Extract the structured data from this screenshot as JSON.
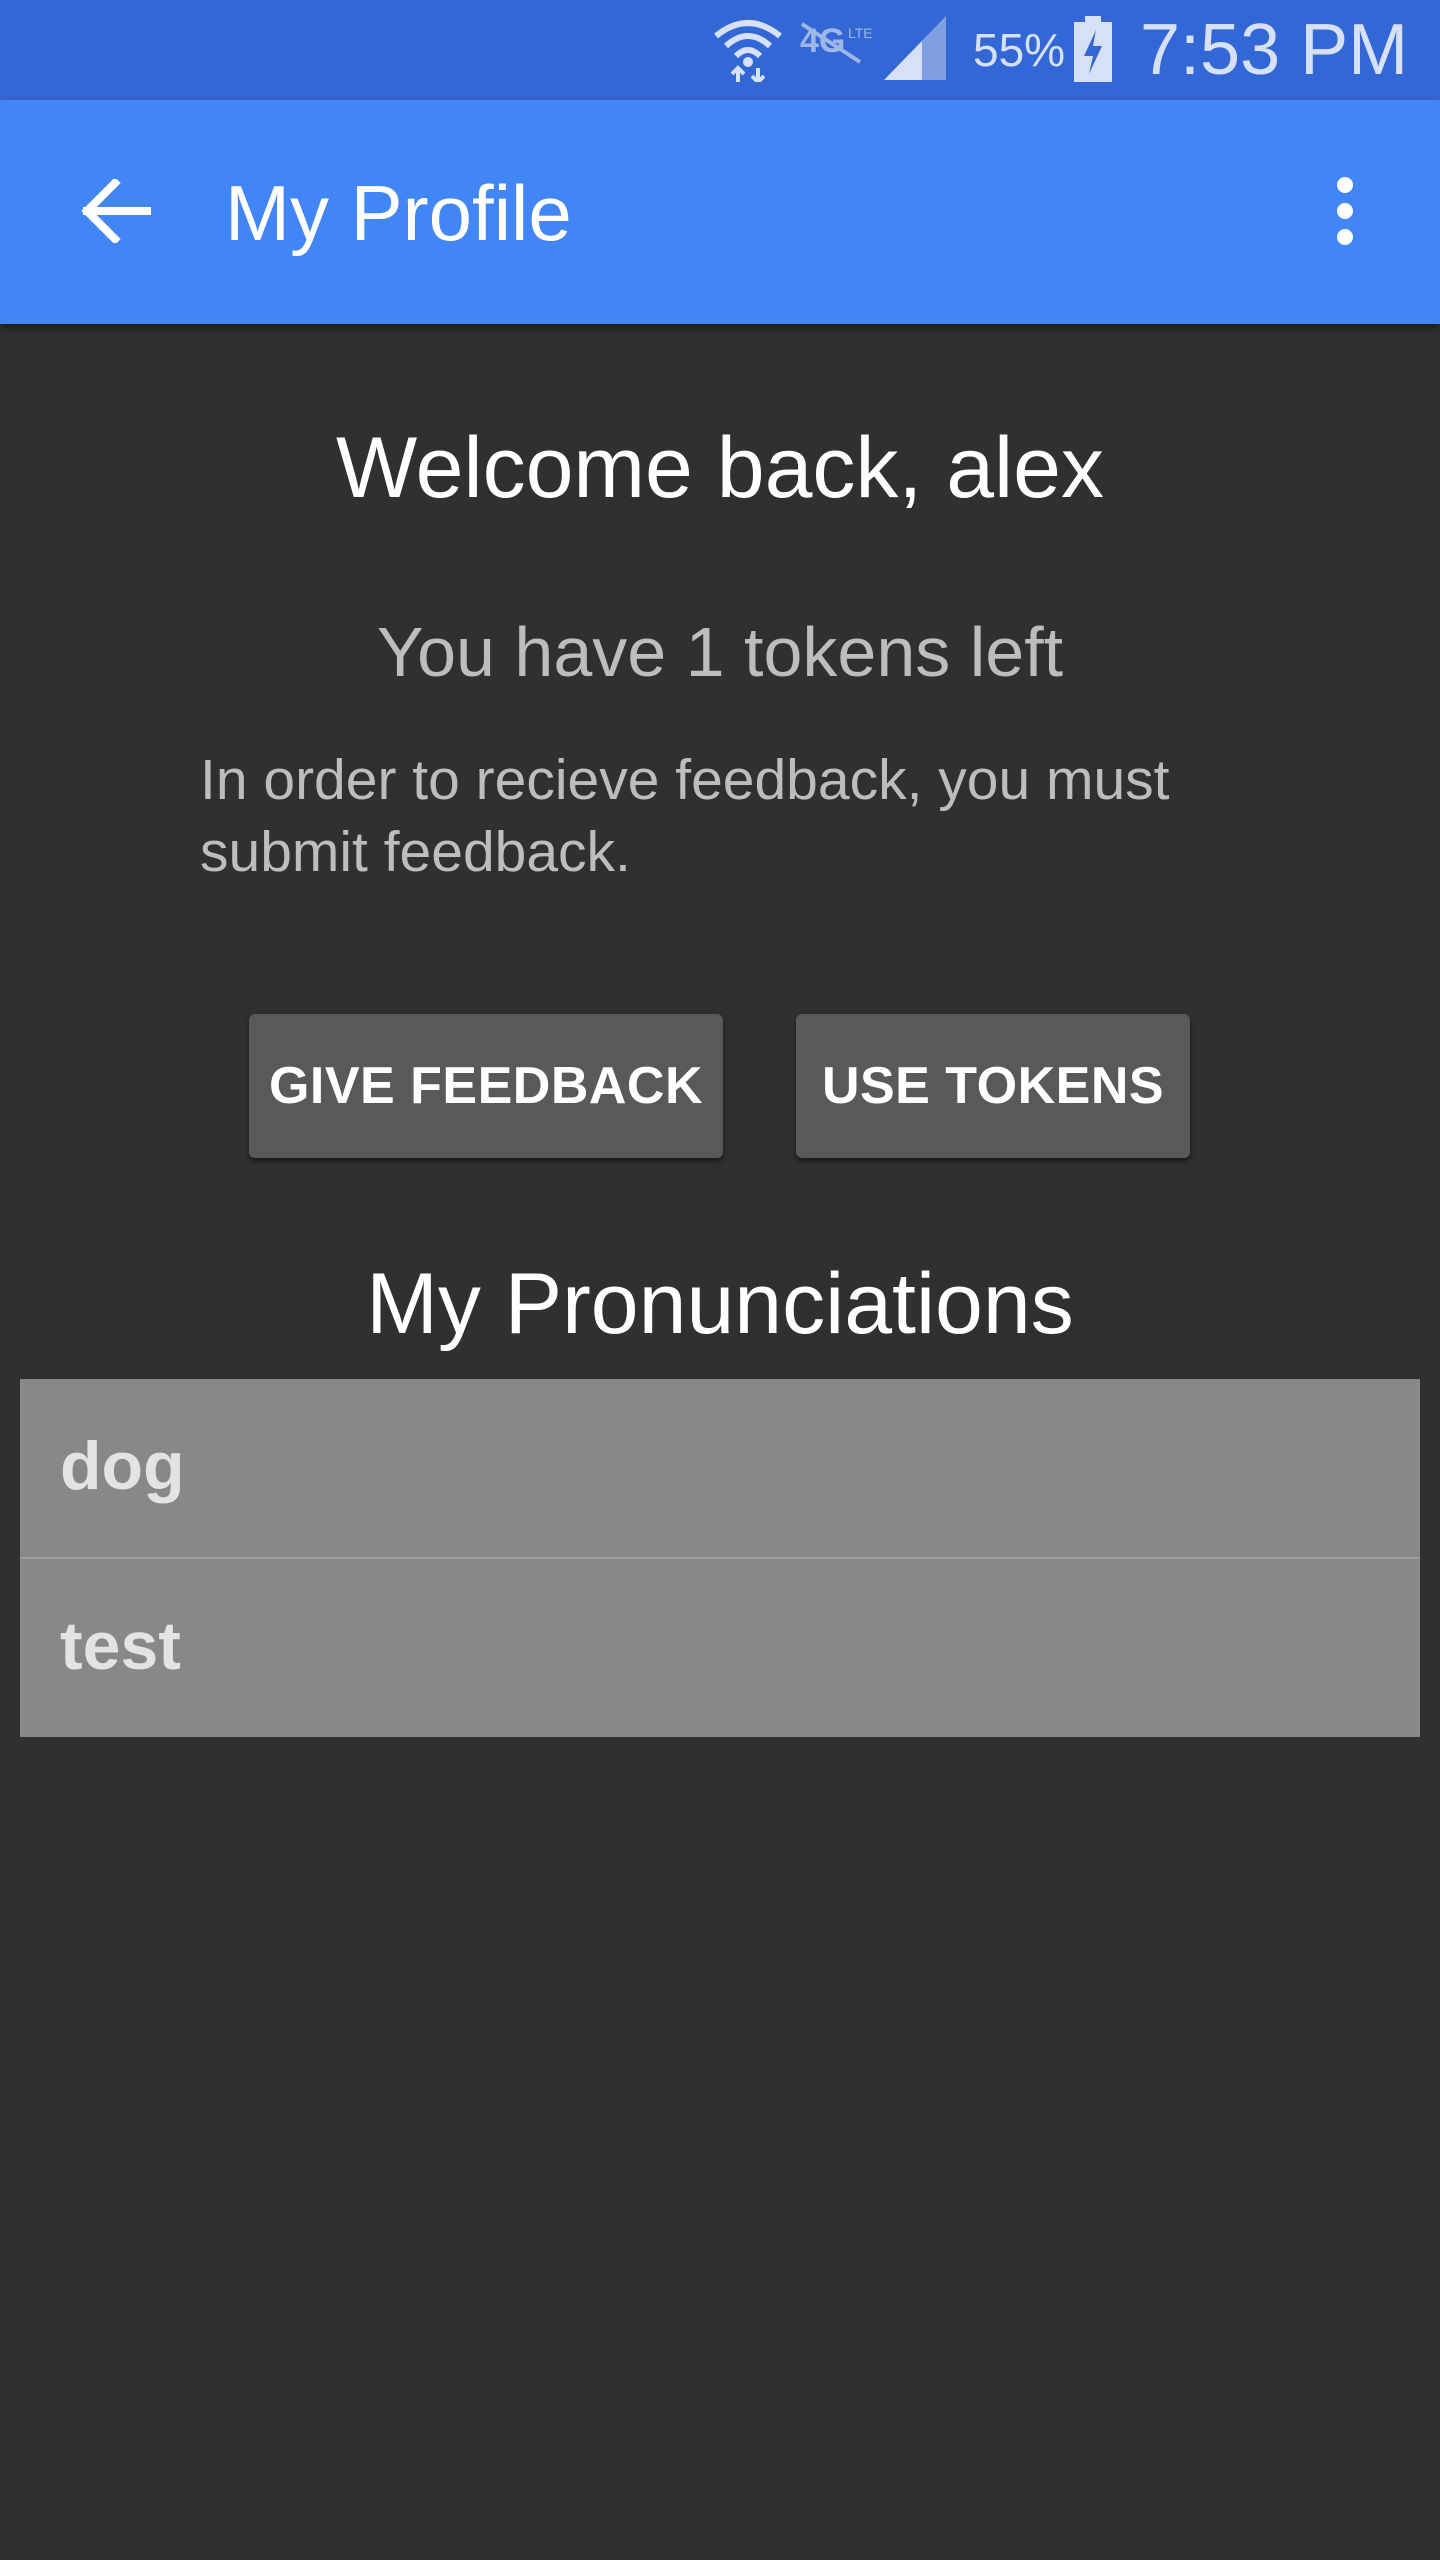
{
  "status_bar": {
    "battery_percent": "55%",
    "time": "7:53 PM",
    "icons": [
      "wifi-icon",
      "lte-icon",
      "signal-icon",
      "battery-charging-icon"
    ]
  },
  "app_bar": {
    "title": "My Profile",
    "back_icon": "arrow-back-icon",
    "menu_icon": "more-vert-icon"
  },
  "profile": {
    "welcome": "Welcome back, alex",
    "tokens_text": "You have 1 tokens left",
    "info_text": "In order to recieve feedback, you must submit feedback."
  },
  "actions": {
    "give_feedback_label": "GIVE FEEDBACK",
    "use_tokens_label": "USE TOKENS"
  },
  "pronunciations": {
    "title": "My Pronunciations",
    "items": [
      {
        "label": "dog"
      },
      {
        "label": "test"
      }
    ]
  },
  "colors": {
    "status_bar": "#3367d6",
    "app_bar": "#4285f4",
    "background": "#303030",
    "button": "#595959",
    "list_background": "#888888"
  }
}
